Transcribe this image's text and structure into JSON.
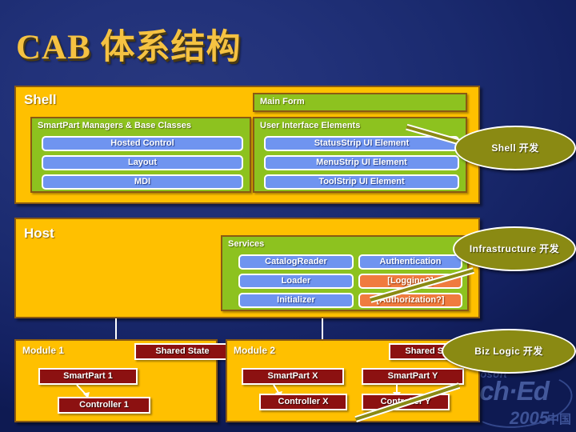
{
  "title": "CAB  体系结构",
  "logo": {
    "microsoft": "Microsoft",
    "teched": "Tech·Ed",
    "year": "2005",
    "region": "中国"
  },
  "shell": {
    "title": "Shell",
    "left_group": {
      "title": "SmartPart Managers & Base Classes",
      "items": [
        {
          "label": "Hosted Control"
        },
        {
          "label": "Layout"
        },
        {
          "label": "MDI"
        }
      ]
    },
    "main_form": {
      "title": "Main Form"
    },
    "right_group": {
      "title": "User Interface Elements",
      "items": [
        {
          "label": "StatusStrip UI Element"
        },
        {
          "label": "MenuStrip UI Element"
        },
        {
          "label": "ToolStrip UI Element"
        }
      ]
    }
  },
  "host": {
    "title": "Host",
    "services": {
      "title": "Services",
      "left_column": [
        {
          "label": "CatalogReader",
          "kind": "blue"
        },
        {
          "label": "Loader",
          "kind": "blue"
        },
        {
          "label": "Initializer",
          "kind": "blue"
        }
      ],
      "right_column": [
        {
          "label": "Authentication",
          "kind": "blue"
        },
        {
          "label": "[Logging?]",
          "kind": "orange"
        },
        {
          "label": "[Authorization?]",
          "kind": "orange"
        }
      ]
    }
  },
  "modules": [
    {
      "title": "Module 1",
      "shared_state": "Shared State",
      "parts": [
        {
          "smartpart": "SmartPart 1",
          "controller": "Controller 1"
        }
      ]
    },
    {
      "title": "Module 2",
      "shared_state": "Shared State",
      "parts": [
        {
          "smartpart": "SmartPart X",
          "controller": "Controller X"
        },
        {
          "smartpart": "SmartPart Y",
          "controller": "Controller Y"
        }
      ]
    }
  ],
  "callouts": [
    {
      "text": "Shell 开发"
    },
    {
      "text": "Infrastructure 开发"
    },
    {
      "text": "Biz Logic 开发"
    }
  ],
  "colors": {
    "background_navy": "#1a2a6e",
    "panel_gold": "#FFC000",
    "group_green": "#8DC21F",
    "pill_blue": "#6F94F0",
    "pill_orange": "#F07B3F",
    "pill_red": "#8C1111",
    "callout_olive": "#8A8A13",
    "title_gold": "#F5C242"
  }
}
